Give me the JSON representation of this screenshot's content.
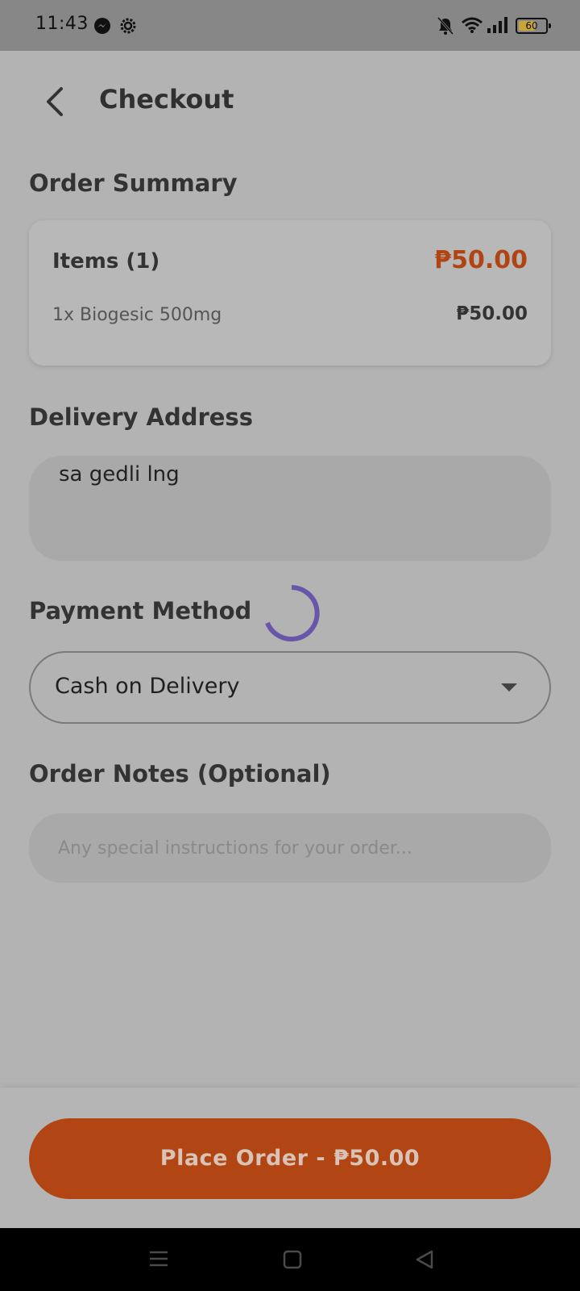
{
  "status_bar": {
    "time": "11:43",
    "battery_level": "60",
    "icons": [
      "messenger-icon",
      "settings-icon",
      "mute-icon",
      "wifi-icon",
      "signal-icon",
      "battery-icon"
    ]
  },
  "header": {
    "title": "Checkout",
    "back_icon": "chevron-left-icon"
  },
  "order_summary": {
    "title": "Order Summary",
    "items_label": "Items (1)",
    "items_total": "₱50.00",
    "lines": [
      {
        "name": "1x Biogesic 500mg",
        "price": "₱50.00"
      }
    ]
  },
  "delivery": {
    "title": "Delivery Address",
    "value": "sa gedli lng"
  },
  "payment": {
    "title": "Payment Method",
    "selected": "Cash on Delivery"
  },
  "notes": {
    "title": "Order Notes (Optional)",
    "placeholder": "Any special instructions for your order..."
  },
  "place_order": {
    "label": "Place Order - ₱50.00"
  },
  "colors": {
    "accent": "#b24514",
    "spinner": "#6a56a8"
  }
}
